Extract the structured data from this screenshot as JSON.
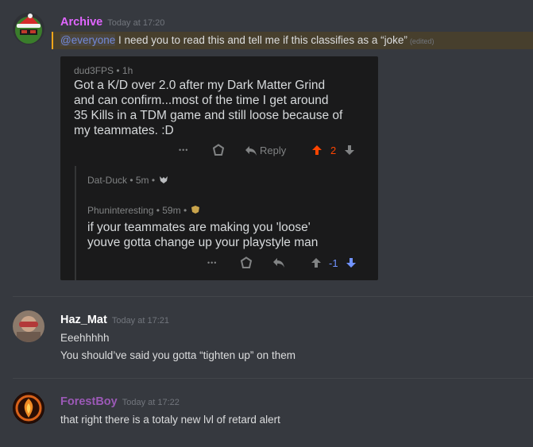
{
  "messages": [
    {
      "author": "Archive",
      "author_color": "#e066ff",
      "time": "Today at 17:20",
      "mention": "@everyone",
      "text": " I need you to read this and tell me if this classifies as a “joke”",
      "edited": "(edited)"
    },
    {
      "author": "Haz_Mat",
      "author_color": "#ffffff",
      "time": "Today at 17:21",
      "lines": [
        "Eeehhhhh",
        "You should’ve said you gotta “tighten up” on them"
      ]
    },
    {
      "author": "ForestBoy",
      "author_color": "#9b59b6",
      "time": "Today at 17:22",
      "lines": [
        "that right there is a totaly new lvl of retard alert"
      ]
    }
  ],
  "embed": {
    "post": {
      "meta": "dud3FPS • 1h",
      "body_lines": [
        "Got a K/D over 2.0 after my Dark Matter Grind",
        "and can confirm...most of the time I get around",
        "35 Kills in a TDM game and still loose because of",
        "my teammates. :D"
      ],
      "more": "•••",
      "reply_label": "Reply",
      "score": "2"
    },
    "reply1": {
      "meta": "Dat-Duck • 5m •"
    },
    "reply2": {
      "meta": "Phuninteresting • 59m •",
      "body_lines": [
        "if your teammates are making you 'loose'",
        "youve gotta change up your playstyle man"
      ],
      "more": "•••",
      "score": "-1"
    }
  }
}
